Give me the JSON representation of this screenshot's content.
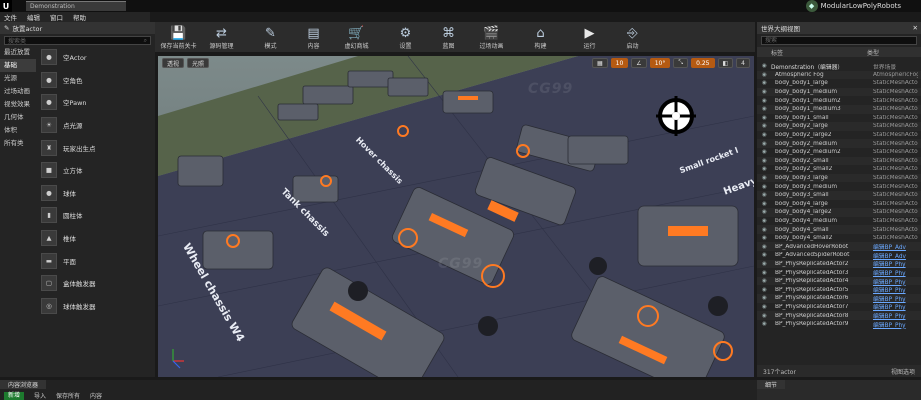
{
  "app": {
    "logo": "U",
    "document_tab": "Demonstration",
    "project": "ModularLowPolyRobots"
  },
  "menu": [
    "文件",
    "编辑",
    "窗口",
    "帮助"
  ],
  "toolbar": [
    {
      "label": "保存当前关卡",
      "icon": "save"
    },
    {
      "label": "源码管理",
      "icon": "source"
    },
    {
      "label": "模式",
      "icon": "modes"
    },
    {
      "label": "内容",
      "icon": "content"
    },
    {
      "label": "虚幻商城",
      "icon": "market"
    },
    {
      "label": "设置",
      "icon": "settings"
    },
    {
      "label": "蓝图",
      "icon": "blueprint"
    },
    {
      "label": "过场动画",
      "icon": "cinematics"
    },
    {
      "label": "构建",
      "icon": "build"
    },
    {
      "label": "运行",
      "icon": "play"
    },
    {
      "label": "启动",
      "icon": "launch"
    }
  ],
  "place_panel": {
    "tab": "放置actor",
    "search_placeholder": "搜索类",
    "categories": [
      "最近放置",
      "基础",
      "光源",
      "过场动画",
      "视觉效果",
      "几何体",
      "体积",
      "所有类"
    ],
    "selected_category": 1,
    "items": [
      {
        "label": "空Actor",
        "icon": "sphere"
      },
      {
        "label": "空角色",
        "icon": "sphere"
      },
      {
        "label": "空Pawn",
        "icon": "sphere"
      },
      {
        "label": "点光源",
        "icon": "bulb"
      },
      {
        "label": "玩家出生点",
        "icon": "player"
      },
      {
        "label": "立方体",
        "icon": "cube"
      },
      {
        "label": "球体",
        "icon": "sphere"
      },
      {
        "label": "圆柱体",
        "icon": "cylinder"
      },
      {
        "label": "椎体",
        "icon": "cone"
      },
      {
        "label": "平面",
        "icon": "plane"
      },
      {
        "label": "盒体触发器",
        "icon": "box"
      },
      {
        "label": "球体触发器",
        "icon": "sphere-trigger"
      }
    ]
  },
  "viewport": {
    "perspective": "透视",
    "lit": "光照",
    "snap_values": [
      "10",
      "10°",
      "0.25",
      "4"
    ],
    "scene_labels": [
      "Tank chassis",
      "Wheel chassis W4",
      "Hover chassis",
      "Small rocket l",
      "Heavy"
    ]
  },
  "outliner": {
    "tab": "世界大纲视图",
    "search_placeholder": "搜索",
    "col_label": "标签",
    "col_type": "类型",
    "rows": [
      {
        "name": "Demonstration（编辑器）",
        "type": "世界场景",
        "root": true
      },
      {
        "name": "Atmospheric Fog",
        "type": "AtmosphericFog"
      },
      {
        "name": "body_body1_large",
        "type": "StaticMeshActor"
      },
      {
        "name": "body_body1_medium",
        "type": "StaticMeshActor"
      },
      {
        "name": "body_body1_medium2",
        "type": "StaticMeshActor"
      },
      {
        "name": "body_body1_medium3",
        "type": "StaticMeshActor"
      },
      {
        "name": "body_body1_small",
        "type": "StaticMeshActor"
      },
      {
        "name": "body_body2_large",
        "type": "StaticMeshActor"
      },
      {
        "name": "body_body2_large2",
        "type": "StaticMeshActor"
      },
      {
        "name": "body_body2_medium",
        "type": "StaticMeshActor"
      },
      {
        "name": "body_body2_medium2",
        "type": "StaticMeshActor"
      },
      {
        "name": "body_body2_small",
        "type": "StaticMeshActor"
      },
      {
        "name": "body_body2_small2",
        "type": "StaticMeshActor"
      },
      {
        "name": "body_body3_large",
        "type": "StaticMeshActor"
      },
      {
        "name": "body_body3_medium",
        "type": "StaticMeshActor"
      },
      {
        "name": "body_body3_small",
        "type": "StaticMeshActor"
      },
      {
        "name": "body_body4_large",
        "type": "StaticMeshActor"
      },
      {
        "name": "body_body4_large2",
        "type": "StaticMeshActor"
      },
      {
        "name": "body_body4_medium",
        "type": "StaticMeshActor"
      },
      {
        "name": "body_body4_small",
        "type": "StaticMeshActor"
      },
      {
        "name": "body_body4_small2",
        "type": "StaticMeshActor"
      },
      {
        "name": "BP_AdvancedHoverRobot",
        "type": "编辑BP_Adv",
        "link": true
      },
      {
        "name": "BP_AdvancedSpiderRobot",
        "type": "编辑BP_Adv",
        "link": true
      },
      {
        "name": "BP_PhysReplicatedActor2",
        "type": "编辑BP_Phy",
        "link": true
      },
      {
        "name": "BP_PhysReplicatedActor3",
        "type": "编辑BP_Phy",
        "link": true
      },
      {
        "name": "BP_PhysReplicatedActor4",
        "type": "编辑BP_Phy",
        "link": true
      },
      {
        "name": "BP_PhysReplicatedActor5",
        "type": "编辑BP_Phy",
        "link": true
      },
      {
        "name": "BP_PhysReplicatedActor6",
        "type": "编辑BP_Phy",
        "link": true
      },
      {
        "name": "BP_PhysReplicatedActor7",
        "type": "编辑BP_Phy",
        "link": true
      },
      {
        "name": "BP_PhysReplicatedActor8",
        "type": "编辑BP_Phy",
        "link": true
      },
      {
        "name": "BP_PhysReplicatedActor9",
        "type": "编辑BP_Phy",
        "link": true
      }
    ],
    "footer_count": "317个actor",
    "footer_view": "视图选项"
  },
  "details": {
    "tab": "细节"
  },
  "content_browser": {
    "tab": "内容浏览器",
    "add_label": "新增",
    "import_label": "导入",
    "save_label": "保存所有",
    "path": "内容"
  },
  "watermark": "CG99"
}
